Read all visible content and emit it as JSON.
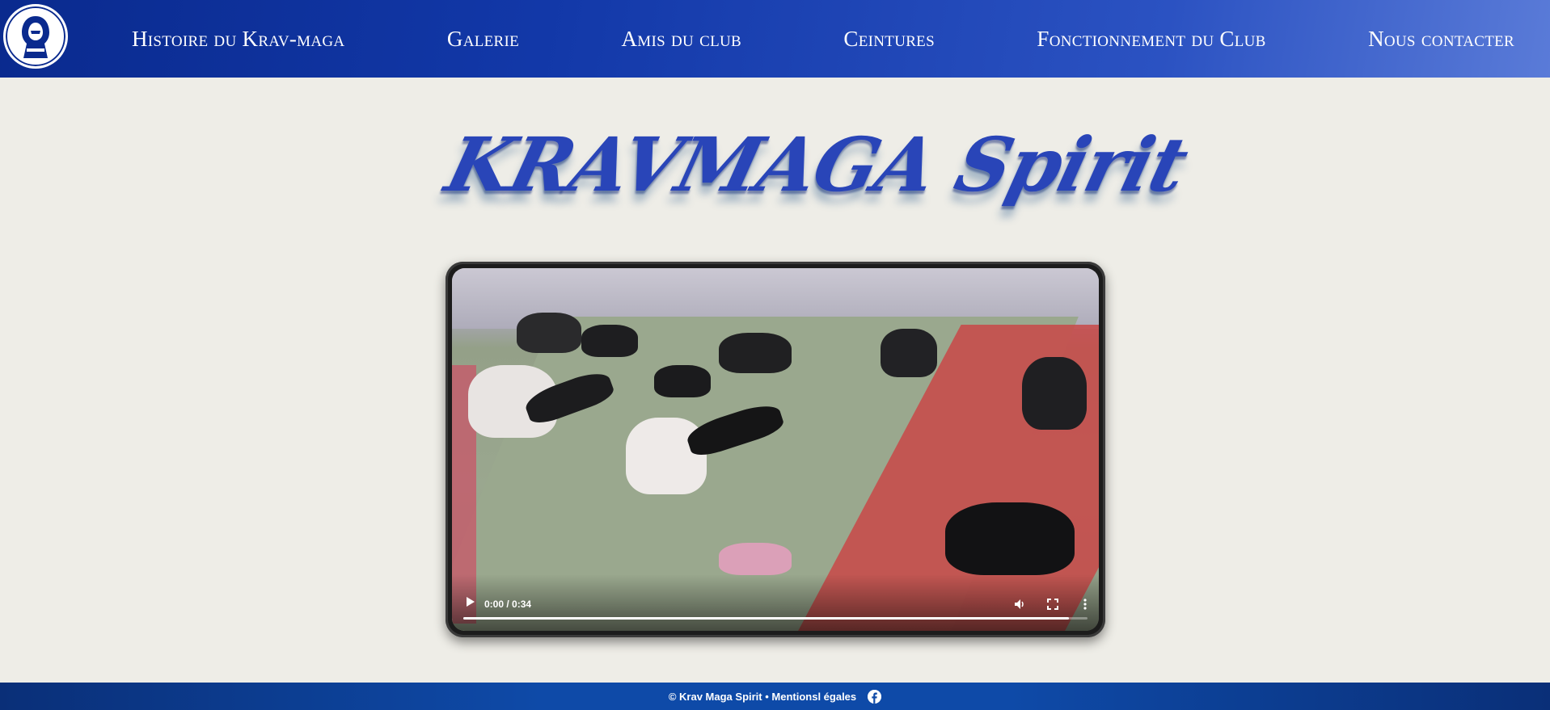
{
  "header": {
    "logo_icon": "hooded-fighter-logo",
    "nav": [
      {
        "label": "Histoire du Krav-maga"
      },
      {
        "label": "Galerie"
      },
      {
        "label": "Amis du club"
      },
      {
        "label": "Ceintures"
      },
      {
        "label": "Fonctionnement du Club"
      },
      {
        "label": "Nous contacter"
      }
    ]
  },
  "brand": {
    "title": "KRAVMAGA Spirit",
    "color": "#2945b8"
  },
  "video": {
    "time": "0:00 / 0:34",
    "progress": 0.97,
    "icons": [
      "play-icon",
      "volume-icon",
      "fullscreen-icon",
      "more-options-icon"
    ]
  },
  "footer": {
    "text": "© Krav Maga Spirit • Mentionsl égales",
    "social_icon": "facebook-icon"
  },
  "colors": {
    "nav_start": "#0a2a8e",
    "nav_end": "#5a7bd8",
    "page_bg": "#eeede7",
    "footer": "#0e4aa8"
  }
}
